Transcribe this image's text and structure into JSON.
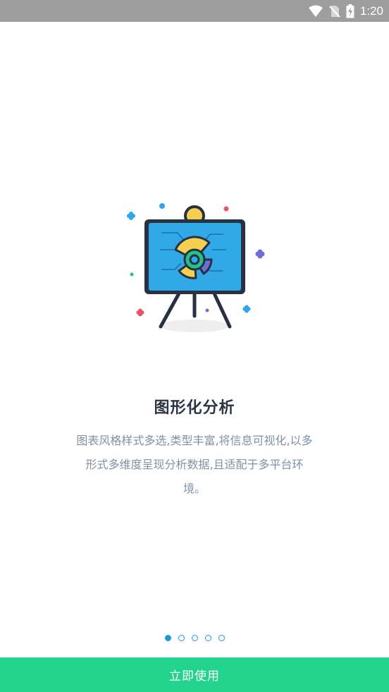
{
  "status_bar": {
    "time": "1:20",
    "icons": [
      "wifi-icon",
      "no-sim-icon",
      "battery-charging-icon"
    ]
  },
  "onboarding": {
    "illustration": "presentation-board-pie-chart-icon",
    "title": "图形化分析",
    "description": "图表风格样式多选,类型丰富,将信息可视化,以多形式多维度呈现分析数据,且适配于多平台环境。",
    "page_count": 5,
    "current_page": 1
  },
  "cta": {
    "label": "立即使用"
  },
  "colors": {
    "status_bar": "#9e9e9e",
    "accent_green": "#22d38e",
    "accent_blue": "#1b9bd6",
    "title_text": "#2b3546",
    "body_text": "#8190a4"
  }
}
